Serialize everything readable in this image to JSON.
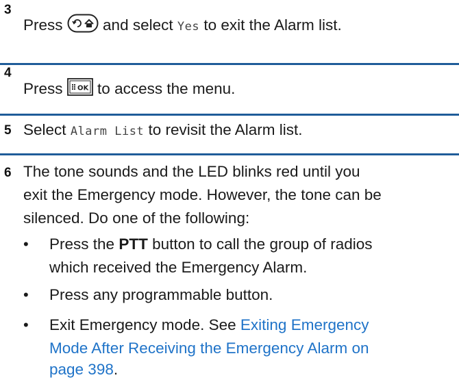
{
  "steps": [
    {
      "number": "3",
      "pre": "Press",
      "key_icon": "back-home-key-icon",
      "mid": "and select",
      "lcd": "Yes",
      "post": "to exit the Alarm list."
    },
    {
      "number": "4",
      "pre": "Press",
      "key_icon": "menu-ok-key-icon",
      "key_label": "OK",
      "post": "to access the menu."
    },
    {
      "number": "5",
      "pre": "Select",
      "lcd": "Alarm List",
      "post": "to revisit the Alarm list."
    },
    {
      "number": "6",
      "lines": [
        "The tone sounds and the LED blinks red until you",
        "exit the Emergency mode. However, the tone can be",
        "silenced. Do one of the following:"
      ],
      "bullets": [
        {
          "pre": "Press the",
          "bold": "PTT",
          "post": "button to call the group of radios",
          "line2": "which received the Emergency Alarm."
        },
        {
          "text": "Press any programmable button."
        },
        {
          "pre": "Exit Emergency mode. See",
          "link_line1": "Exiting Emergency",
          "link_line2": "Mode After Receiving the Emergency Alarm on",
          "link_line3": "page 398",
          "post": "."
        }
      ]
    }
  ],
  "colors": {
    "rule": "#1f5c99",
    "link": "#1f73c8",
    "text": "#1a1a1a"
  }
}
